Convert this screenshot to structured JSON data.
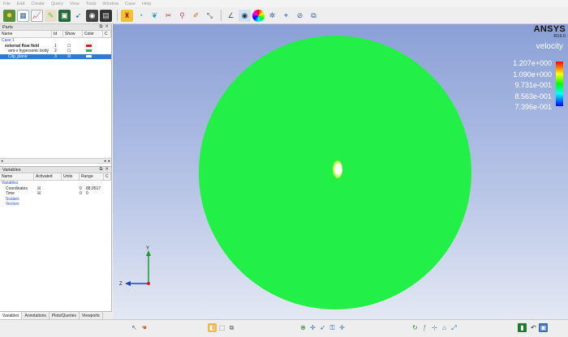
{
  "menu": [
    "File",
    "Edit",
    "Create",
    "Query",
    "View",
    "Tools",
    "Window",
    "Case",
    "Help"
  ],
  "toolbar": {
    "icons": [
      "parts-icon",
      "grid-icon",
      "chart-icon",
      "tools-icon",
      "image-icon",
      "vector-icon",
      "camera-icon",
      "film-icon",
      "palette-icon",
      "annotate-icon",
      "color-drop-icon",
      "cut-icon",
      "pin-icon",
      "brush-icon",
      "view-icon",
      "eye-icon",
      "color-wheel-icon",
      "rotate-icon",
      "select-icon",
      "hide-icon",
      "box-icon"
    ]
  },
  "parts_panel": {
    "title": "Parts",
    "columns": [
      "Name",
      "Id",
      "Show",
      "Color",
      "C"
    ],
    "rows": [
      {
        "name": "Case 1",
        "id": "",
        "show": "",
        "color": "",
        "indent": 0,
        "selected": false,
        "blue": true,
        "bold": false
      },
      {
        "name": "external flow field",
        "id": "1",
        "show": "☐",
        "color": "#d62020",
        "indent": 1,
        "selected": false,
        "blue": false,
        "bold": true
      },
      {
        "name": "ami-v hypersonic body",
        "id": "2",
        "show": "☐",
        "color": "#2fb34a",
        "indent": 2,
        "selected": false,
        "blue": false,
        "bold": false
      },
      {
        "name": "Clip_plane",
        "id": "3",
        "show": "☒",
        "color": "#ffffff",
        "indent": 2,
        "selected": true,
        "blue": false,
        "bold": false
      }
    ]
  },
  "variables_panel": {
    "title": "Variables",
    "columns": [
      "Name",
      "Activated",
      "Units",
      "Range",
      "C"
    ],
    "rows": [
      {
        "name": "Variables",
        "activated": "",
        "units": "",
        "range_min": "",
        "range_max": "",
        "indent": 0,
        "blue": true
      },
      {
        "name": "Coordinates",
        "activated": "☒",
        "units": "",
        "range_min": "0",
        "range_max": "88.0517",
        "indent": 1,
        "blue": false
      },
      {
        "name": "Time",
        "activated": "☒",
        "units": "",
        "range_min": "0",
        "range_max": "0",
        "indent": 1,
        "blue": false
      },
      {
        "name": "Scalars",
        "activated": "",
        "units": "",
        "range_min": "",
        "range_max": "",
        "indent": 1,
        "blue": true
      },
      {
        "name": "Vectors",
        "activated": "",
        "units": "",
        "range_min": "",
        "range_max": "",
        "indent": 1,
        "blue": true
      }
    ]
  },
  "tabs": [
    "Variables",
    "Annotations",
    "Plots/Queries",
    "Viewports"
  ],
  "viewport": {
    "brand": "ANSYS",
    "version": "R19.0",
    "legend_title": "velocity",
    "legend_values": [
      "1.207e+000",
      "1.090e+000",
      "9.731e-001",
      "8.563e-001",
      "7.396e-001"
    ],
    "axis_labels": {
      "y": "Y",
      "z": "Z"
    }
  },
  "colors": {
    "surface": "#22f046",
    "selection": "#3179d4"
  }
}
